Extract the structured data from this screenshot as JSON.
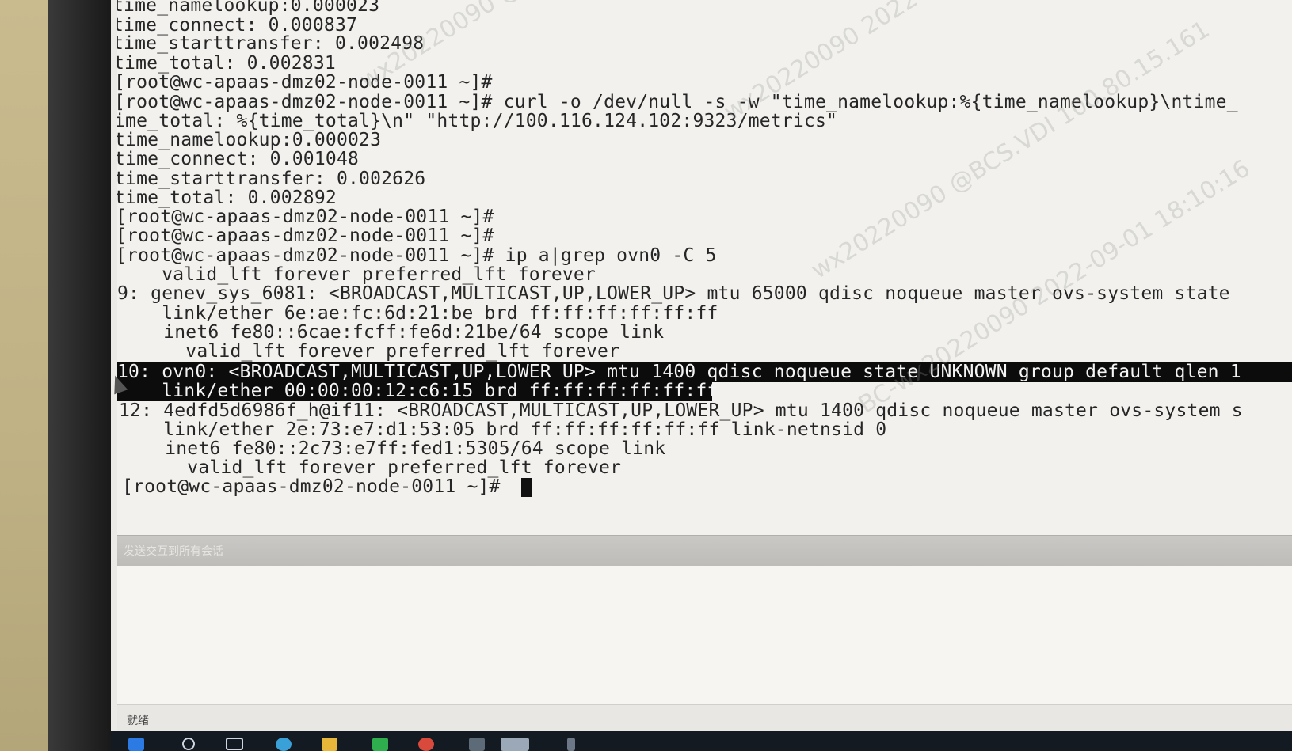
{
  "terminal": {
    "lines": [
      {
        "text": "time_namelookup:0.000023"
      },
      {
        "text": "time_connect: 0.000837"
      },
      {
        "text": "time_starttransfer: 0.002498"
      },
      {
        "text": "time_total: 0.002831"
      },
      {
        "text": "[root@wc-apaas-dmz02-node-0011 ~]#"
      },
      {
        "text": "[root@wc-apaas-dmz02-node-0011 ~]# curl -o /dev/null -s -w \"time_namelookup:%{time_namelookup}\\ntime_"
      },
      {
        "text": "ime_total: %{time_total}\\n\" \"http://100.116.124.102:9323/metrics\""
      },
      {
        "text": "time_namelookup:0.000023"
      },
      {
        "text": "time_connect: 0.001048"
      },
      {
        "text": "time_starttransfer: 0.002626"
      },
      {
        "text": "time_total: 0.002892"
      },
      {
        "text": "[root@wc-apaas-dmz02-node-0011 ~]#"
      },
      {
        "text": "[root@wc-apaas-dmz02-node-0011 ~]#"
      },
      {
        "text": "[root@wc-apaas-dmz02-node-0011 ~]# ip a|grep ovn0 -C 5"
      },
      {
        "text": "    valid_lft forever preferred_lft forever"
      },
      {
        "text": "9: genev_sys_6081: <BROADCAST,MULTICAST,UP,LOWER_UP> mtu 65000 qdisc noqueue master ovs-system state"
      },
      {
        "text": "    link/ether 6e:ae:fc:6d:21:be brd ff:ff:ff:ff:ff:ff"
      },
      {
        "text": "    inet6 fe80::6cae:fcff:fe6d:21be/64 scope link"
      },
      {
        "text": "      valid_lft forever preferred_lft forever"
      },
      {
        "text": "10: ovn0: <BROADCAST,MULTICAST,UP,LOWER_UP> mtu 1400 qdisc noqueue state UNKNOWN group default qlen 1"
      },
      {
        "text": "    link/ether 00:00:00:12:c6:15 brd ff:ff:ff:ff:ff:ff"
      },
      {
        "text": "12: 4edfd5d6986f_h@if11: <BROADCAST,MULTICAST,UP,LOWER_UP> mtu 1400 qdisc noqueue master ovs-system s"
      },
      {
        "text": "    link/ether 2e:73:e7:d1:53:05 brd ff:ff:ff:ff:ff:ff link-netnsid 0"
      },
      {
        "text": "    inet6 fe80::2c73:e7ff:fed1:5305/64 scope link"
      },
      {
        "text": "      valid_lft forever preferred_lft forever"
      },
      {
        "text": "[root@wc-apaas-dmz02-node-0011 ~]#"
      }
    ]
  },
  "send_bar": {
    "label": "发送交互到所有会话"
  },
  "statusbar": {
    "status": "就绪"
  },
  "watermarks": [
    "wx20220090 @BCS.VDI 100.80.15.161",
    "wx20220090 2022-09-01 18:10:16",
    "wx20220090 @BCS.VDI 100.80.15.161",
    "BC-wx20220090 2022-09-01 18:10:16"
  ],
  "colors": {
    "terminal_bg": "#f2f1ee",
    "terminal_text": "#262626",
    "selection_bg": "#0c0c0c",
    "selection_text": "#f4f4f4"
  },
  "taskbar": {
    "icons": [
      "windows-start-icon",
      "search-icon",
      "task-view-icon",
      "edge-browser-icon",
      "file-explorer-icon",
      "green-app-icon",
      "red-app-icon",
      "app-icon",
      "active-app-icon",
      "app-icon"
    ]
  }
}
